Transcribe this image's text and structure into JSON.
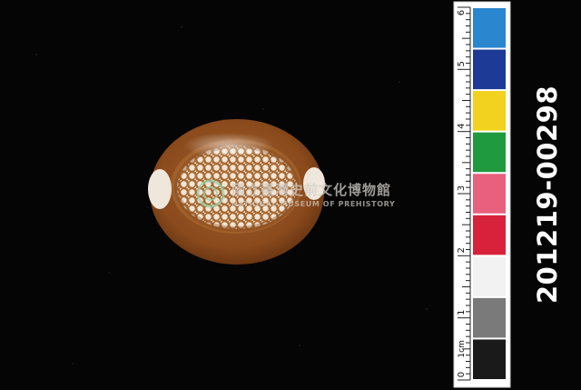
{
  "specimen_id": "201219-00298",
  "watermark": {
    "chinese": "國立臺灣史前文化博物館",
    "english": "NATIONAL MUSEUM OF PREHISTORY"
  },
  "scale_bar": {
    "unit_label": "1cm",
    "major_labels": [
      "0",
      "1",
      "2",
      "3",
      "4",
      "5",
      "6"
    ],
    "color_patches": [
      "#1a1a1a",
      "#7a7a7a",
      "#f2f2f2",
      "#d8213a",
      "#e9607e",
      "#1f9a3f",
      "#f2d21e",
      "#1c3a96",
      "#2a86cf"
    ]
  },
  "subject": {
    "name": "cowrie-shell",
    "colors": {
      "base": "#8a4a1c",
      "dark": "#5a2c0e",
      "spots": "#f3ece0",
      "edge": "#f1ebe3"
    }
  }
}
